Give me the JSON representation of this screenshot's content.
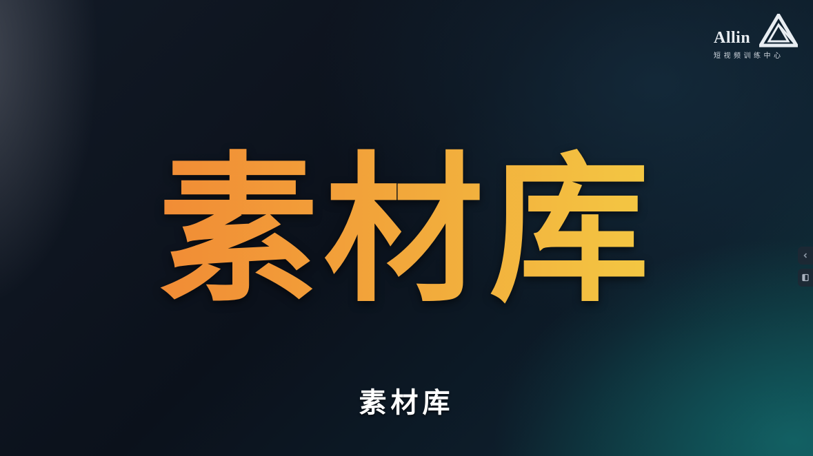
{
  "logo": {
    "wordmark": "Allin",
    "tagline": "短视频训练中心"
  },
  "slide": {
    "title": "素材库",
    "subtitle": "素材库"
  },
  "side_tabs": [
    {
      "icon": "chevron-left-icon"
    },
    {
      "icon": "document-icon"
    }
  ],
  "colors": {
    "title_gradient_start": "#f07a32",
    "title_gradient_end": "#f4dc48",
    "subtitle": "#ffffff",
    "background": "#0d1420",
    "accent_teal": "#0f3a40"
  }
}
